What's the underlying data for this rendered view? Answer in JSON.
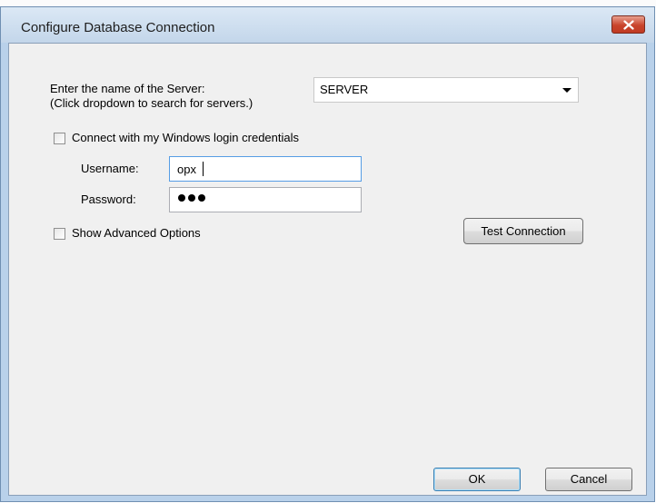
{
  "dialog": {
    "title": "Configure Database Connection"
  },
  "server": {
    "label_line1": "Enter the name of the Server:",
    "label_line2": "(Click dropdown to search for servers.)",
    "value": "SERVER"
  },
  "windows_login": {
    "label": "Connect with my Windows login credentials",
    "checked": false
  },
  "username": {
    "label": "Username:",
    "value": "opx"
  },
  "password": {
    "label": "Password:",
    "masked_length": 3
  },
  "advanced": {
    "label": "Show Advanced Options",
    "checked": false
  },
  "buttons": {
    "test_connection": "Test Connection",
    "ok": "OK",
    "cancel": "Cancel"
  },
  "icons": {
    "close": "close-icon",
    "dropdown": "chevron-down-icon"
  },
  "colors": {
    "titlebar": "#c8dbee",
    "close_button": "#c9442c",
    "client_background": "#f0f0f0",
    "focus_border": "#569de5"
  }
}
